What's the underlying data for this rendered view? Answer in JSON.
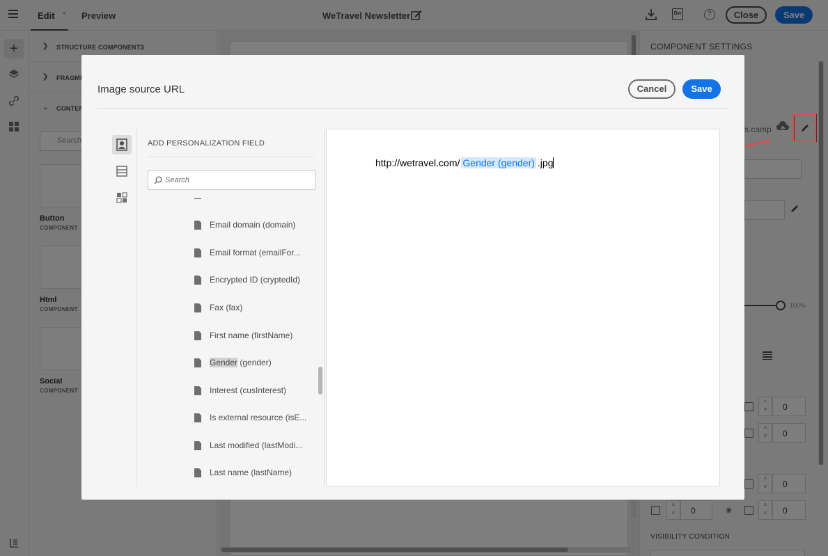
{
  "topbar": {
    "edit_label": "Edit",
    "preview_label": "Preview",
    "title": "WeTravel Newsletter",
    "dw_label": "Dw",
    "help_label": "?",
    "close_label": "Close",
    "save_label": "Save"
  },
  "left_panel": {
    "sections": [
      {
        "label": "STRUCTURE COMPONENTS"
      },
      {
        "label": "FRAGMEN"
      },
      {
        "label": "CONTENT"
      }
    ],
    "search_placeholder": "Search",
    "components": [
      {
        "name": "Button",
        "sub": "COMPONENT"
      },
      {
        "name": "Html",
        "sub": "COMPONENT"
      },
      {
        "name": "Social",
        "sub": "COMPONENT"
      }
    ]
  },
  "right_panel": {
    "title": "COMPONENT SETTINGS",
    "file_text": "s.camp",
    "percent": "100%",
    "values": [
      "0",
      "0",
      "0",
      "0",
      "0",
      "0"
    ],
    "visibility_label": "VISIBILITY CONDITION"
  },
  "modal": {
    "title": "Image source URL",
    "cancel_label": "Cancel",
    "save_label": "Save",
    "list_title": "ADD PERSONALIZATION FIELD",
    "search_placeholder": "Search",
    "items": [
      "Email domain (domain)",
      "Email format (emailFor...",
      "Encrypted ID (cryptedId)",
      "Fax (fax)",
      "First name (firstName)",
      "Gender (gender)",
      "Interest (cusInterest)",
      "Is external resource (isE...",
      "Last modified (lastModi...",
      "Last name (lastName)"
    ],
    "highlight_word": "Gender",
    "highlight_rest": " (gender)",
    "url_prefix": "http://wetravel.com/",
    "url_token": "Gender (gender)",
    "url_suffix": ".jpg"
  },
  "colors": {
    "accent": "#1473e6",
    "annotation_red": "#e34850"
  }
}
